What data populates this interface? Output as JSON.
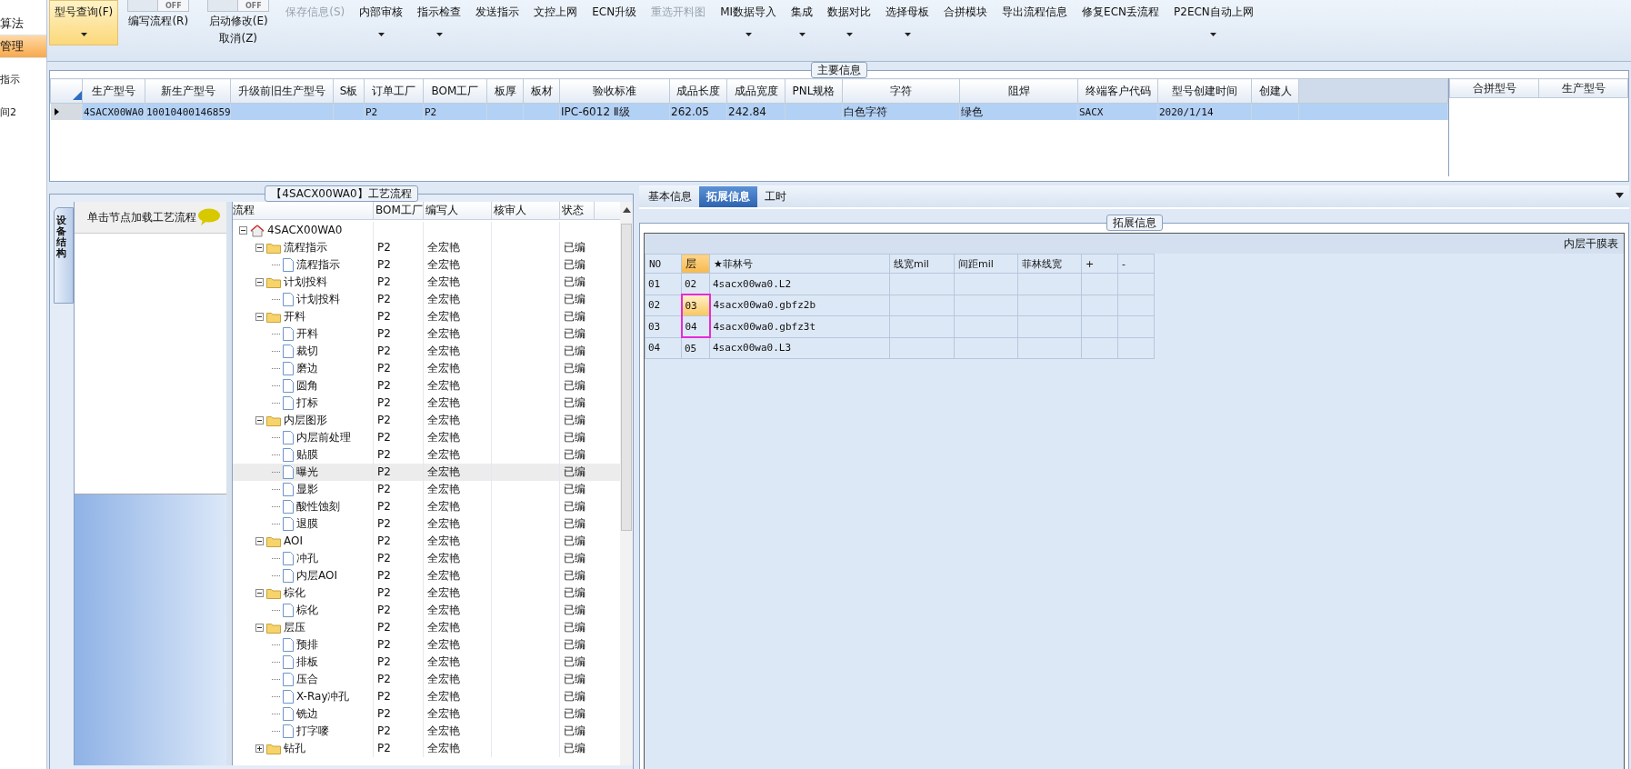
{
  "nav": [
    {
      "label": "算法",
      "selected": false
    },
    {
      "label": "管理",
      "selected": true
    },
    {
      "label": "指示",
      "selected": false
    },
    {
      "label": "间2",
      "selected": false
    }
  ],
  "toolbar": [
    {
      "kind": "button",
      "label": "型号查询(F)",
      "dropdown": true,
      "selected": true,
      "disabled": false
    },
    {
      "kind": "toggle",
      "label": "编写流程(R)",
      "toggle": "OFF",
      "on": false
    },
    {
      "kind": "toggle",
      "label": "启动修改(E)",
      "label2": "取消(Z)",
      "toggle": "OFF",
      "on": false
    },
    {
      "kind": "button",
      "label": "保存信息(S)",
      "dropdown": false,
      "selected": false,
      "disabled": true
    },
    {
      "kind": "button",
      "label": "内部审核",
      "dropdown": true,
      "selected": false,
      "disabled": false
    },
    {
      "kind": "button",
      "label": "指示检查",
      "dropdown": true,
      "selected": false,
      "disabled": false
    },
    {
      "kind": "button",
      "label": "发送指示",
      "dropdown": false,
      "selected": false,
      "disabled": false
    },
    {
      "kind": "button",
      "label": "文控上网",
      "dropdown": false,
      "selected": false,
      "disabled": false
    },
    {
      "kind": "button",
      "label": "ECN升级",
      "dropdown": false,
      "selected": false,
      "disabled": false
    },
    {
      "kind": "button",
      "label": "重选开料图",
      "dropdown": false,
      "selected": false,
      "disabled": true
    },
    {
      "kind": "button",
      "label": "MI数据导入",
      "dropdown": true,
      "selected": false,
      "disabled": false
    },
    {
      "kind": "button",
      "label": "集成",
      "dropdown": true,
      "selected": false,
      "disabled": false
    },
    {
      "kind": "button",
      "label": "数据对比",
      "dropdown": true,
      "selected": false,
      "disabled": false
    },
    {
      "kind": "button",
      "label": "选择母板",
      "dropdown": true,
      "selected": false,
      "disabled": false
    },
    {
      "kind": "button",
      "label": "合拼模块",
      "dropdown": false,
      "selected": false,
      "disabled": false
    },
    {
      "kind": "button",
      "label": "导出流程信息",
      "dropdown": false,
      "selected": false,
      "disabled": false
    },
    {
      "kind": "button",
      "label": "修复ECN丢流程",
      "dropdown": false,
      "selected": false,
      "disabled": false
    },
    {
      "kind": "button",
      "label": "P2ECN自动上网",
      "dropdown": true,
      "selected": false,
      "disabled": false
    }
  ],
  "main_info": {
    "title": "主要信息",
    "columns": [
      "生产型号",
      "新生产型号",
      "升级前旧生产型号",
      "S板",
      "订单工厂",
      "BOM工厂",
      "板厚",
      "板材",
      "验收标准",
      "成品长度",
      "成品宽度",
      "PNL规格",
      "字符",
      "阻焊",
      "终端客户代码",
      "型号创建时间",
      "创建人"
    ],
    "rows": [
      {
        "selected": true,
        "cells": [
          "4SACX00WA0",
          "10010400146859",
          "",
          "",
          "P2",
          "P2",
          "",
          "",
          "IPC-6012 Ⅱ级",
          "262.05",
          "242.84",
          "",
          "白色字符",
          "绿色",
          "SACX",
          "2020/1/14",
          ""
        ]
      }
    ],
    "merge_columns": [
      "合拼型号",
      "生产型号"
    ]
  },
  "flow_panel": {
    "title": "【4SACX00WA0】工艺流程",
    "side_tab": "设备结构",
    "hint": "单击节点加载工艺流程",
    "columns": [
      "流程",
      "BOM工厂",
      "编写人",
      "核审人",
      "状态"
    ],
    "tree": [
      {
        "kind": "root",
        "label": "4SACX00WA0",
        "expanded": true,
        "selected": false,
        "children": [
          {
            "kind": "folder",
            "label": "流程指示",
            "bom": "P2",
            "writer": "全宏艳",
            "status": "已编",
            "expanded": true,
            "selected": false,
            "children": [
              {
                "kind": "file",
                "label": "流程指示",
                "bom": "P2",
                "writer": "全宏艳",
                "status": "已编",
                "selected": false
              }
            ]
          },
          {
            "kind": "folder",
            "label": "计划投料",
            "bom": "P2",
            "writer": "全宏艳",
            "status": "已编",
            "expanded": true,
            "selected": false,
            "children": [
              {
                "kind": "file",
                "label": "计划投料",
                "bom": "P2",
                "writer": "全宏艳",
                "status": "已编",
                "selected": false
              }
            ]
          },
          {
            "kind": "folder",
            "label": "开料",
            "bom": "P2",
            "writer": "全宏艳",
            "status": "已编",
            "expanded": true,
            "selected": false,
            "children": [
              {
                "kind": "file",
                "label": "开料",
                "bom": "P2",
                "writer": "全宏艳",
                "status": "已编",
                "selected": false
              },
              {
                "kind": "file",
                "label": "裁切",
                "bom": "P2",
                "writer": "全宏艳",
                "status": "已编",
                "selected": false
              },
              {
                "kind": "file",
                "label": "磨边",
                "bom": "P2",
                "writer": "全宏艳",
                "status": "已编",
                "selected": false
              },
              {
                "kind": "file",
                "label": "圆角",
                "bom": "P2",
                "writer": "全宏艳",
                "status": "已编",
                "selected": false
              },
              {
                "kind": "file",
                "label": "打标",
                "bom": "P2",
                "writer": "全宏艳",
                "status": "已编",
                "selected": false
              }
            ]
          },
          {
            "kind": "folder",
            "label": "内层图形",
            "bom": "P2",
            "writer": "全宏艳",
            "status": "已编",
            "expanded": true,
            "selected": false,
            "children": [
              {
                "kind": "file",
                "label": "内层前处理",
                "bom": "P2",
                "writer": "全宏艳",
                "status": "已编",
                "selected": false
              },
              {
                "kind": "file",
                "label": "贴膜",
                "bom": "P2",
                "writer": "全宏艳",
                "status": "已编",
                "selected": false
              },
              {
                "kind": "file",
                "label": "曝光",
                "bom": "P2",
                "writer": "全宏艳",
                "status": "已编",
                "selected": true
              },
              {
                "kind": "file",
                "label": "显影",
                "bom": "P2",
                "writer": "全宏艳",
                "status": "已编",
                "selected": false
              },
              {
                "kind": "file",
                "label": "酸性蚀刻",
                "bom": "P2",
                "writer": "全宏艳",
                "status": "已编",
                "selected": false
              },
              {
                "kind": "file",
                "label": "退膜",
                "bom": "P2",
                "writer": "全宏艳",
                "status": "已编",
                "selected": false
              }
            ]
          },
          {
            "kind": "folder",
            "label": "AOI",
            "bom": "P2",
            "writer": "全宏艳",
            "status": "已编",
            "expanded": true,
            "selected": false,
            "children": [
              {
                "kind": "file",
                "label": "冲孔",
                "bom": "P2",
                "writer": "全宏艳",
                "status": "已编",
                "selected": false
              },
              {
                "kind": "file",
                "label": "内层AOI",
                "bom": "P2",
                "writer": "全宏艳",
                "status": "已编",
                "selected": false
              }
            ]
          },
          {
            "kind": "folder",
            "label": "棕化",
            "bom": "P2",
            "writer": "全宏艳",
            "status": "已编",
            "expanded": true,
            "selected": false,
            "children": [
              {
                "kind": "file",
                "label": "棕化",
                "bom": "P2",
                "writer": "全宏艳",
                "status": "已编",
                "selected": false
              }
            ]
          },
          {
            "kind": "folder",
            "label": "层压",
            "bom": "P2",
            "writer": "全宏艳",
            "status": "已编",
            "expanded": true,
            "selected": false,
            "children": [
              {
                "kind": "file",
                "label": "预排",
                "bom": "P2",
                "writer": "全宏艳",
                "status": "已编",
                "selected": false
              },
              {
                "kind": "file",
                "label": "排板",
                "bom": "P2",
                "writer": "全宏艳",
                "status": "已编",
                "selected": false
              },
              {
                "kind": "file",
                "label": "压合",
                "bom": "P2",
                "writer": "全宏艳",
                "status": "已编",
                "selected": false
              },
              {
                "kind": "file",
                "label": "X-Ray冲孔",
                "bom": "P2",
                "writer": "全宏艳",
                "status": "已编",
                "selected": false
              },
              {
                "kind": "file",
                "label": "铣边",
                "bom": "P2",
                "writer": "全宏艳",
                "status": "已编",
                "selected": false
              },
              {
                "kind": "file",
                "label": "打字嘜",
                "bom": "P2",
                "writer": "全宏艳",
                "status": "已编",
                "selected": false
              }
            ]
          },
          {
            "kind": "folder",
            "label": "钻孔",
            "bom": "P2",
            "writer": "全宏艳",
            "status": "已编",
            "expanded": false,
            "selected": false
          }
        ]
      }
    ]
  },
  "detail_panel": {
    "tabs": [
      {
        "label": "基本信息",
        "selected": false
      },
      {
        "label": "拓展信息",
        "selected": true
      },
      {
        "label": "工时",
        "selected": false
      }
    ],
    "group_title": "拓展信息",
    "table_title": "内层干膜表",
    "columns": [
      {
        "label": "NO",
        "selected": false
      },
      {
        "label": "层",
        "selected": true
      },
      {
        "label": "★菲林号",
        "selected": false
      },
      {
        "label": "线宽mil",
        "selected": false
      },
      {
        "label": "间距mil",
        "selected": false
      },
      {
        "label": "菲林线宽",
        "selected": false
      },
      {
        "label": "+",
        "selected": false
      },
      {
        "label": "-",
        "selected": false
      }
    ],
    "rows": [
      {
        "no": "01",
        "layer": "02",
        "film": "4sacx00wa0.L2",
        "selected": false,
        "marked": false
      },
      {
        "no": "02",
        "layer": "03",
        "film": "4sacx00wa0.gbfz2b",
        "selected": true,
        "marked": true
      },
      {
        "no": "03",
        "layer": "04",
        "film": "4sacx00wa0.gbfz3t",
        "selected": false,
        "marked": true
      },
      {
        "no": "04",
        "layer": "05",
        "film": "4sacx00wa0.L3",
        "selected": false,
        "marked": false
      }
    ]
  }
}
